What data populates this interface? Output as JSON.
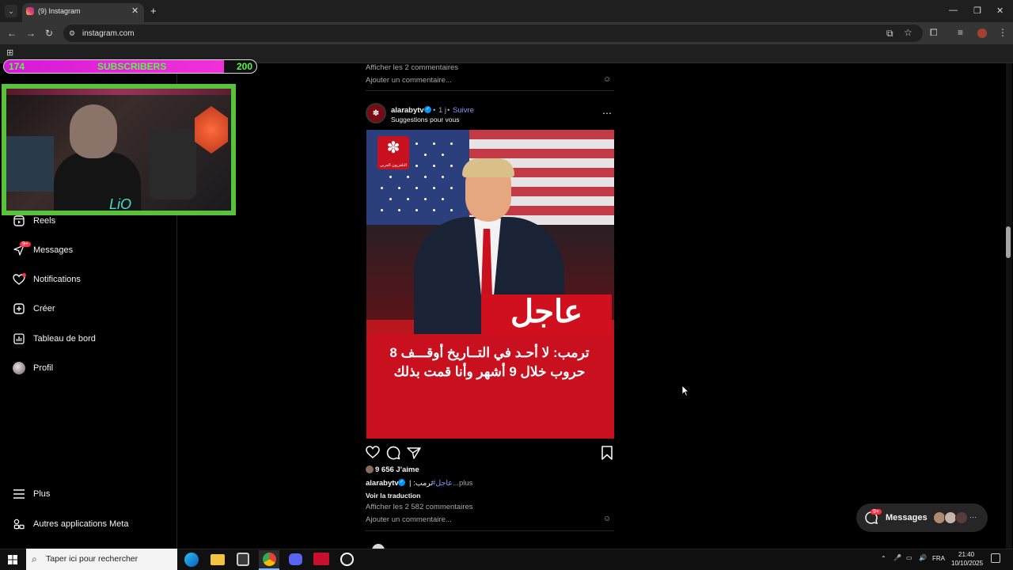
{
  "browser": {
    "tab_title": "(9) Instagram",
    "url": "instagram.com"
  },
  "overlay": {
    "subscribers_current": "174",
    "subscribers_label": "SUBSCRIBERS",
    "subscribers_goal": "200",
    "progress": 0.87,
    "cam_signature": "LiO"
  },
  "sidebar": {
    "items": [
      {
        "label": "Reels",
        "icon": "reels-icon"
      },
      {
        "label": "Messages",
        "icon": "messages-icon",
        "badge": "9+"
      },
      {
        "label": "Notifications",
        "icon": "heart-icon"
      },
      {
        "label": "Créer",
        "icon": "plus-square-icon"
      },
      {
        "label": "Tableau de bord",
        "icon": "bar-chart-icon"
      },
      {
        "label": "Profil",
        "icon": "avatar"
      }
    ],
    "more": "Plus",
    "meta_apps": "Autres applications Meta"
  },
  "prev_post": {
    "view_comments": "Afficher les 2 commentaires",
    "add_comment": "Ajouter un commentaire..."
  },
  "post": {
    "username": "alarabytv",
    "time": "1 j",
    "follow": "Suivre",
    "dot": "•",
    "suggestion": "Suggestions pour vous",
    "image": {
      "badge": "عاجل",
      "headline": "ترمب: لا أحـد في التــاريخ أوقـــف 8 حروب خلال 9 أشهر وأنا قمت بذلك",
      "logo_sub": "التلفزيون العربي"
    },
    "likes": "9 656 J'aime",
    "caption_user": "alarabytv",
    "caption_text": "ترمب: |",
    "caption_hashtag": "#عاجل...",
    "caption_more": "plus",
    "translate": "Voir la traduction",
    "view_comments": "Afficher les 2 582 commentaires",
    "add_comment": "Ajouter un commentaire..."
  },
  "messages_float": {
    "label": "Messages",
    "badge": "9+"
  },
  "taskbar": {
    "search_placeholder": "Taper ici pour rechercher",
    "lang": "FRA",
    "time": "21:40",
    "date": "10/10/2025"
  }
}
